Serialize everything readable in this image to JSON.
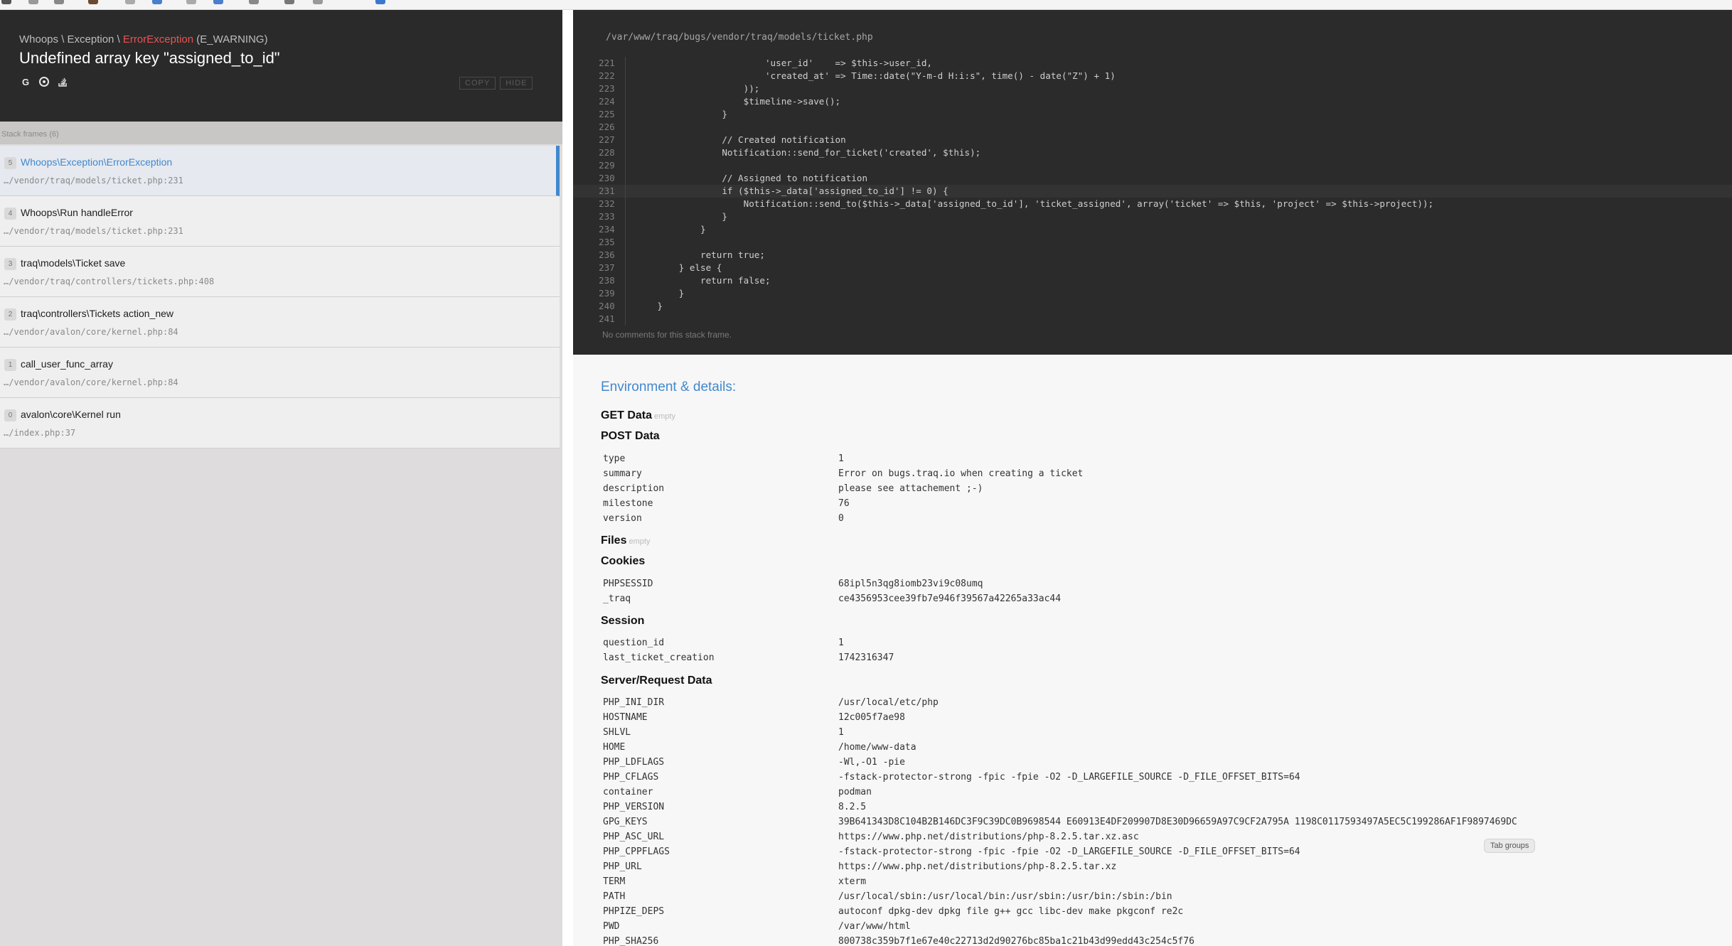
{
  "exception": {
    "prefix": "Whoops \\ Exception \\ ",
    "class": "ErrorException",
    "severity": " (E_WARNING)",
    "message": "Undefined array key \"assigned_to_id\""
  },
  "header_buttons": {
    "copy": "COPY",
    "hide": "HIDE"
  },
  "frames_label": "Stack frames (6)",
  "frames": [
    {
      "index": "5",
      "class": "Whoops\\Exception\\ErrorException",
      "file": "…/vendor/traq/models/ticket.php:231"
    },
    {
      "index": "4",
      "class": "Whoops\\Run handleError",
      "file": "…/vendor/traq/models/ticket.php:231"
    },
    {
      "index": "3",
      "class": "traq\\models\\Ticket save",
      "file": "…/vendor/traq/controllers/tickets.php:408"
    },
    {
      "index": "2",
      "class": "traq\\controllers\\Tickets action_new",
      "file": "…/vendor/avalon/core/kernel.php:84"
    },
    {
      "index": "1",
      "class": "call_user_func_array",
      "file": "…/vendor/avalon/core/kernel.php:84"
    },
    {
      "index": "0",
      "class": "avalon\\core\\Kernel run",
      "file": "…/index.php:37"
    }
  ],
  "code": {
    "path": "/var/www/traq/bugs/vendor/traq/models/ticket.php",
    "lines": [
      {
        "n": "221",
        "text": "                        'user_id'    => $this->user_id,"
      },
      {
        "n": "222",
        "text": "                        'created_at' => Time::date(\"Y-m-d H:i:s\", time() - date(\"Z\") + 1)"
      },
      {
        "n": "223",
        "text": "                    ));"
      },
      {
        "n": "224",
        "text": "                    $timeline->save();"
      },
      {
        "n": "225",
        "text": "                }"
      },
      {
        "n": "226",
        "text": ""
      },
      {
        "n": "227",
        "text": "                // Created notification"
      },
      {
        "n": "228",
        "text": "                Notification::send_for_ticket('created', $this);"
      },
      {
        "n": "229",
        "text": ""
      },
      {
        "n": "230",
        "text": "                // Assigned to notification"
      },
      {
        "n": "231",
        "text": "                if ($this->_data['assigned_to_id'] != 0) {"
      },
      {
        "n": "232",
        "text": "                    Notification::send_to($this->_data['assigned_to_id'], 'ticket_assigned', array('ticket' => $this, 'project' => $this->project));"
      },
      {
        "n": "233",
        "text": "                }"
      },
      {
        "n": "234",
        "text": "            }"
      },
      {
        "n": "235",
        "text": ""
      },
      {
        "n": "236",
        "text": "            return true;"
      },
      {
        "n": "237",
        "text": "        } else {"
      },
      {
        "n": "238",
        "text": "            return false;"
      },
      {
        "n": "239",
        "text": "        }"
      },
      {
        "n": "240",
        "text": "    }"
      },
      {
        "n": "241",
        "text": ""
      }
    ],
    "no_comments": "No comments for this stack frame."
  },
  "env": {
    "title": "Environment & details:",
    "empty_label": "empty",
    "get_data": "GET Data",
    "post_data": {
      "title": "POST Data",
      "rows": [
        {
          "k": "type",
          "v": "1"
        },
        {
          "k": "summary",
          "v": "Error on bugs.traq.io when creating a ticket"
        },
        {
          "k": "description",
          "v": "please see attachement ;-)"
        },
        {
          "k": "milestone",
          "v": "76"
        },
        {
          "k": "version",
          "v": "0"
        }
      ]
    },
    "files": "Files",
    "cookies": {
      "title": "Cookies",
      "rows": [
        {
          "k": "PHPSESSID",
          "v": "68ipl5n3qg8iomb23vi9c08umq"
        },
        {
          "k": "_traq",
          "v": "ce4356953cee39fb7e946f39567a42265a33ac44"
        }
      ]
    },
    "session": {
      "title": "Session",
      "rows": [
        {
          "k": "question_id",
          "v": "1"
        },
        {
          "k": "last_ticket_creation",
          "v": "1742316347"
        }
      ]
    },
    "server": {
      "title": "Server/Request Data",
      "rows": [
        {
          "k": "PHP_INI_DIR",
          "v": "/usr/local/etc/php"
        },
        {
          "k": "HOSTNAME",
          "v": "12c005f7ae98"
        },
        {
          "k": "SHLVL",
          "v": "1"
        },
        {
          "k": "HOME",
          "v": "/home/www-data"
        },
        {
          "k": "PHP_LDFLAGS",
          "v": "-Wl,-O1 -pie"
        },
        {
          "k": "PHP_CFLAGS",
          "v": "-fstack-protector-strong -fpic -fpie -O2 -D_LARGEFILE_SOURCE -D_FILE_OFFSET_BITS=64"
        },
        {
          "k": "container",
          "v": "podman"
        },
        {
          "k": "PHP_VERSION",
          "v": "8.2.5"
        },
        {
          "k": "GPG_KEYS",
          "v": "39B641343D8C104B2B146DC3F9C39DC0B9698544 E60913E4DF209907D8E30D96659A97C9CF2A795A 1198C0117593497A5EC5C199286AF1F9897469DC"
        },
        {
          "k": "PHP_ASC_URL",
          "v": "https://www.php.net/distributions/php-8.2.5.tar.xz.asc"
        },
        {
          "k": "PHP_CPPFLAGS",
          "v": "-fstack-protector-strong -fpic -fpie -O2 -D_LARGEFILE_SOURCE -D_FILE_OFFSET_BITS=64"
        },
        {
          "k": "PHP_URL",
          "v": "https://www.php.net/distributions/php-8.2.5.tar.xz"
        },
        {
          "k": "TERM",
          "v": "xterm"
        },
        {
          "k": "PATH",
          "v": "/usr/local/sbin:/usr/local/bin:/usr/sbin:/usr/bin:/sbin:/bin"
        },
        {
          "k": "PHPIZE_DEPS",
          "v": "autoconf dpkg-dev dpkg file g++ gcc libc-dev make pkgconf re2c"
        },
        {
          "k": "PWD",
          "v": "/var/www/html"
        },
        {
          "k": "PHP_SHA256",
          "v": "800738c359b7f1e67e40c22713d2d90276bc85ba1c21b43d99edd43c254c5f76"
        }
      ]
    }
  },
  "tab_groups": "Tab groups",
  "colors": {
    "accent": "#4288ce",
    "error": "#e95353",
    "header_bg": "#2a2a2a"
  },
  "icons": [
    "google-icon",
    "duckduckgo-icon",
    "stack-overflow-icon"
  ]
}
